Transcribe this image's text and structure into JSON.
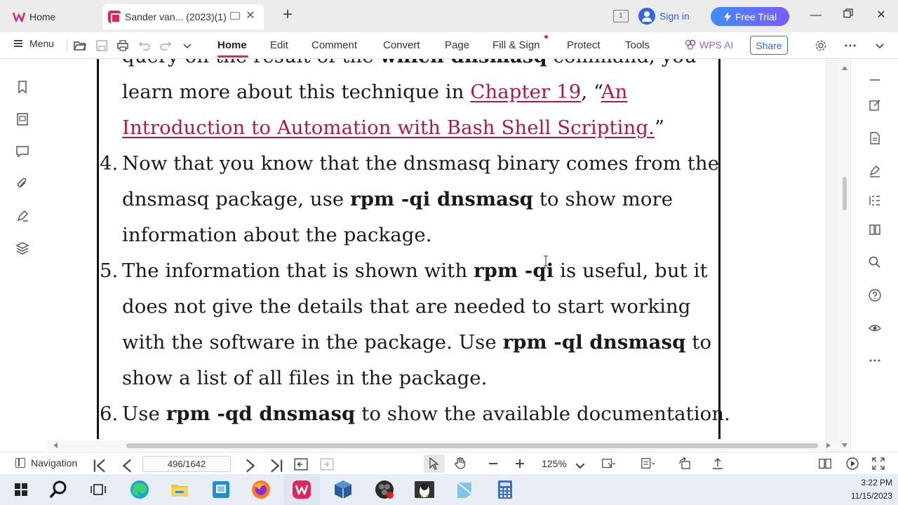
{
  "titlebar": {
    "home_tab": "Home",
    "doc_tab": "Sander van... (2023)(1)",
    "page_indicator": "1",
    "sign_in": "Sign in",
    "free_trial": "Free Trial"
  },
  "toolbar": {
    "menu": "Menu",
    "tabs": [
      "Home",
      "Edit",
      "Comment",
      "Convert",
      "Page",
      "Fill & Sign",
      "Protect",
      "Tools"
    ],
    "active_tab": "Home",
    "wps_ai": "WPS AI",
    "share": "Share",
    "accent_color": "#e0245e"
  },
  "document": {
    "lines": [
      {
        "num": "",
        "segments": [
          {
            "t": "query on the result of the ",
            "b": false
          },
          {
            "t": "which dnsmasq",
            "b": true
          },
          {
            "t": " command, you",
            "b": false
          }
        ]
      },
      {
        "num": "",
        "segments": [
          {
            "t": "learn more about this technique in ",
            "b": false
          },
          {
            "t": "Chapter 19",
            "link": true
          },
          {
            "t": ", “",
            "b": false
          },
          {
            "t": "An",
            "link": true
          }
        ]
      },
      {
        "num": "",
        "segments": [
          {
            "t": "Introduction to Automation with Bash Shell Scripting.",
            "link": true
          },
          {
            "t": "”",
            "b": false
          }
        ]
      },
      {
        "num": "4.",
        "segments": [
          {
            "t": "Now that you know that the dnsmasq binary comes from the",
            "b": false
          }
        ]
      },
      {
        "num": "",
        "segments": [
          {
            "t": "dnsmasq package, use ",
            "b": false
          },
          {
            "t": "rpm -qi dnsmasq",
            "b": true
          },
          {
            "t": " to show more",
            "b": false
          }
        ]
      },
      {
        "num": "",
        "segments": [
          {
            "t": "information about the package.",
            "b": false
          }
        ]
      },
      {
        "num": "5.",
        "segments": [
          {
            "t": "The information that is shown with ",
            "b": false
          },
          {
            "t": "rpm -qi",
            "b": true
          },
          {
            "t": " is useful, but it",
            "b": false
          }
        ]
      },
      {
        "num": "",
        "segments": [
          {
            "t": "does not give the details that are needed to start working",
            "b": false
          }
        ]
      },
      {
        "num": "",
        "segments": [
          {
            "t": "with the software in the package. Use ",
            "b": false
          },
          {
            "t": "rpm -ql dnsmasq",
            "b": true
          },
          {
            "t": " to",
            "b": false
          }
        ]
      },
      {
        "num": "",
        "segments": [
          {
            "t": "show a list of all files in the package.",
            "b": false
          }
        ]
      },
      {
        "num": "6.",
        "segments": [
          {
            "t": "Use ",
            "b": false
          },
          {
            "t": "rpm -qd dnsmasq",
            "b": true
          },
          {
            "t": " to show the available documentation.",
            "b": false
          }
        ]
      }
    ]
  },
  "statusbar": {
    "navigation": "Navigation",
    "page_field": "496/1642",
    "zoom": "125%"
  },
  "taskbar": {
    "time": "3:22 PM",
    "date": "11/15/2023"
  }
}
